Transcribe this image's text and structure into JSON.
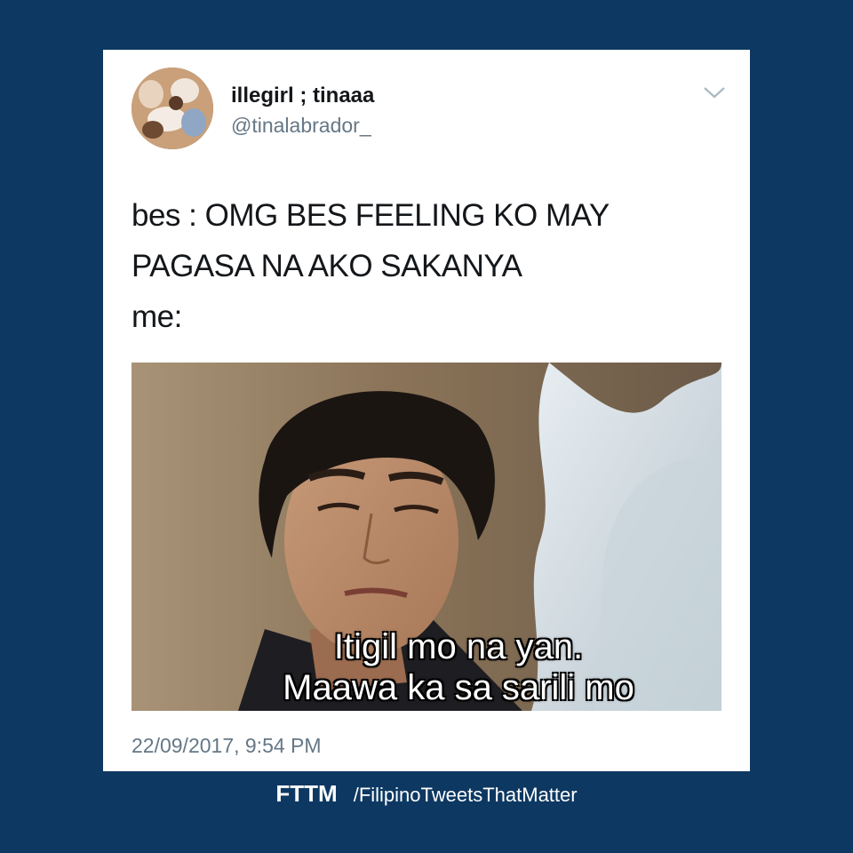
{
  "tweet": {
    "display_name": "illegirl ; tinaaa",
    "handle": "@tinalabrador_",
    "text": "bes : OMG BES FEELING KO MAY\nPAGASA NA AKO SAKANYA\nme:",
    "timestamp": "22/09/2017, 9:54 PM",
    "media": {
      "caption_line1": "Itigil mo na yan.",
      "caption_line2": "Maawa ka sa sarili mo"
    },
    "menu_icon": "chevron-down-icon"
  },
  "footer": {
    "brand": "FTTM",
    "page": "/FilipinoTweetsThatMatter"
  },
  "colors": {
    "background": "#0d3862",
    "card": "#ffffff",
    "secondary_text": "#657786"
  }
}
